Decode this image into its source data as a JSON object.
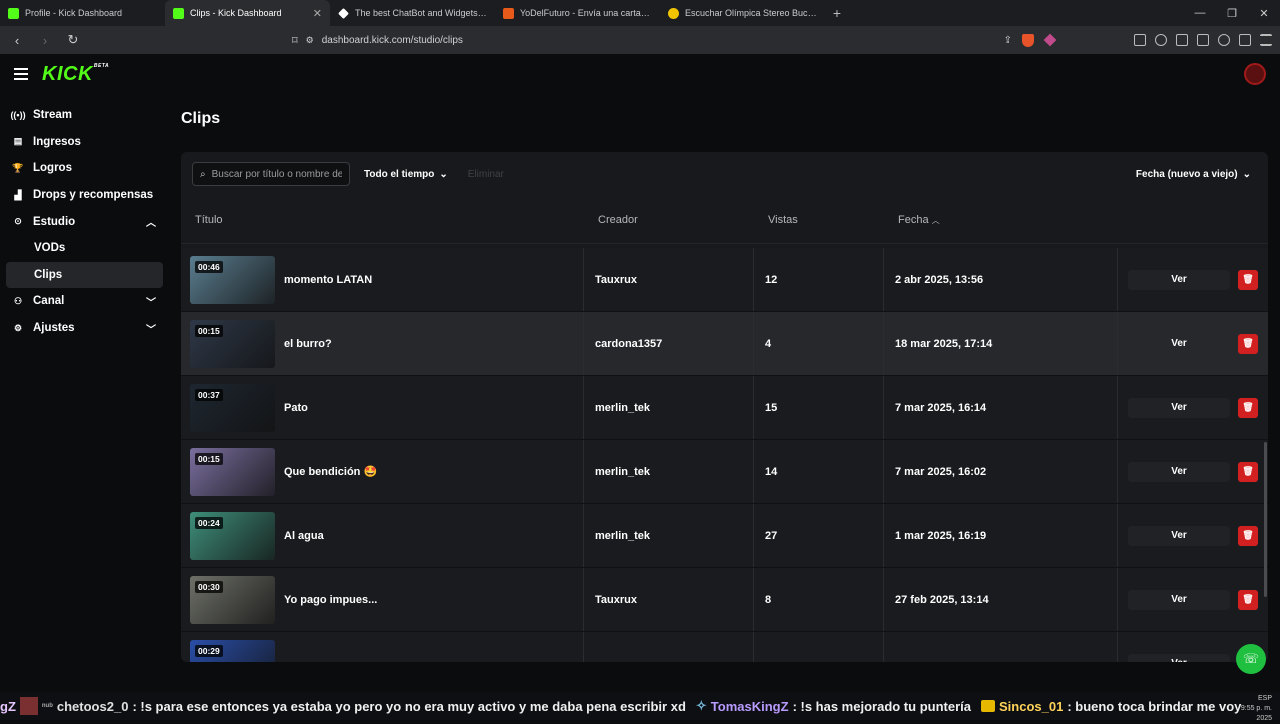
{
  "browser": {
    "tabs": [
      {
        "title": "Profile - Kick Dashboard",
        "color": "#53fc18"
      },
      {
        "title": "Clips - Kick Dashboard",
        "color": "#53fc18"
      },
      {
        "title": "The best ChatBot and Widgets for Ki",
        "color": "#ffffff"
      },
      {
        "title": "YoDelFuturo - Envía una carta a tu yo",
        "color": "#e85a1a"
      },
      {
        "title": "Escuchar Olímpica Stereo Bucaramang",
        "color": "#f2c400"
      }
    ],
    "url": "dashboard.kick.com/studio/clips"
  },
  "brand": {
    "logo": "KICK",
    "beta": "BETA"
  },
  "sidebar": {
    "items": [
      {
        "label": "Stream",
        "icon": "broadcast-icon"
      },
      {
        "label": "Ingresos",
        "icon": "ledger-icon"
      },
      {
        "label": "Logros",
        "icon": "trophy-icon"
      },
      {
        "label": "Drops y recompensas",
        "icon": "chart-icon"
      },
      {
        "label": "Estudio",
        "icon": "studio-icon"
      },
      {
        "label": "VODs"
      },
      {
        "label": "Clips"
      },
      {
        "label": "Canal",
        "icon": "people-icon"
      },
      {
        "label": "Ajustes",
        "icon": "gear-icon"
      }
    ]
  },
  "main": {
    "title": "Clips",
    "search_placeholder": "Buscar por título o nombre de",
    "time_filter": "Todo el tiempo",
    "delete_filter": "Eliminar",
    "sort": "Fecha (nuevo a viejo)",
    "columns": {
      "title": "Título",
      "creator": "Creador",
      "views": "Vistas",
      "date": "Fecha"
    },
    "view_label": "Ver",
    "clips": [
      {
        "duration": "00:46",
        "title": "momento LATAN",
        "creator": "Tauxrux",
        "views": "12",
        "date": "2 abr 2025, 13:56",
        "thumb": "#5a7d8f"
      },
      {
        "duration": "00:15",
        "title": "el burro?",
        "creator": "cardona1357",
        "views": "4",
        "date": "18 mar 2025, 17:14",
        "thumb": "#2e3848"
      },
      {
        "duration": "00:37",
        "title": "Pato",
        "creator": "merlin_tek",
        "views": "15",
        "date": "7 mar 2025, 16:14",
        "thumb": "#1e2630"
      },
      {
        "duration": "00:15",
        "title": "Que bendición 🤩",
        "creator": "merlin_tek",
        "views": "14",
        "date": "7 mar 2025, 16:02",
        "thumb": "#7a6e9e"
      },
      {
        "duration": "00:24",
        "title": "Al agua",
        "creator": "merlin_tek",
        "views": "27",
        "date": "1 mar 2025, 16:19",
        "thumb": "#3e8e7a"
      },
      {
        "duration": "00:30",
        "title": "Yo pago impues...",
        "creator": "Tauxrux",
        "views": "8",
        "date": "27 feb 2025, 13:14",
        "thumb": "#6e7068"
      },
      {
        "duration": "00:29",
        "title": "",
        "creator": "",
        "views": "",
        "date": "",
        "thumb": "#2a4ea8"
      }
    ]
  },
  "ticker": {
    "u0": "gZ",
    "u0_sub": "nub",
    "u1": "chetoos2_0",
    "m1": ": !s para ese entonces ya estaba yo pero yo no era muy activo y me daba pena escribir xd",
    "u2": "TomasKingZ",
    "m2": ": !s has mejorado tu puntería",
    "u3": "Sincos_01",
    "m3": ": bueno toca brindar me voy"
  },
  "tray": {
    "lang": "ESP",
    "time": "9:55 p. m.",
    "date": "2025"
  }
}
